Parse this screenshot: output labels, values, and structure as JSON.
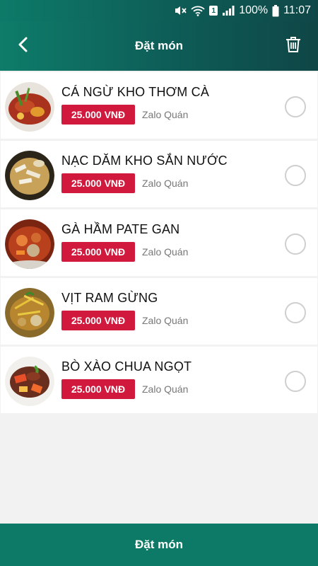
{
  "status_bar": {
    "battery": "100%",
    "time": "11:07",
    "sim_slot": "1",
    "icons": [
      "mute-icon",
      "wifi-icon",
      "sim-icon",
      "signal-icon",
      "battery-icon"
    ]
  },
  "header": {
    "title": "Đặt món",
    "back_icon": "chevron-left-icon",
    "delete_icon": "trash-icon"
  },
  "items": [
    {
      "name": "CÁ NGỪ KHO THƠM CÀ",
      "price": "25.000 VNĐ",
      "shop": "Zalo Quán",
      "image": "fish-stew-photo",
      "selected": false
    },
    {
      "name": "NẠC DĂM KHO SẮN NƯỚC",
      "price": "25.000 VNĐ",
      "shop": "Zalo Quán",
      "image": "pork-jicama-photo",
      "selected": false
    },
    {
      "name": "GÀ HẦM PATE GAN",
      "price": "25.000 VNĐ",
      "shop": "Zalo Quán",
      "image": "chicken-pate-photo",
      "selected": false
    },
    {
      "name": "VỊT RAM GỪNG",
      "price": "25.000 VNĐ",
      "shop": "Zalo Quán",
      "image": "duck-ginger-photo",
      "selected": false
    },
    {
      "name": "BÒ XÀO CHUA NGỌT",
      "price": "25.000 VNĐ",
      "shop": "Zalo Quán",
      "image": "beef-sweet-sour-photo",
      "selected": false
    }
  ],
  "footer": {
    "order_label": "Đặt món"
  },
  "colors": {
    "header": "#0e5c57",
    "price_badge": "#d0193d",
    "order_button": "#0c7a66"
  }
}
